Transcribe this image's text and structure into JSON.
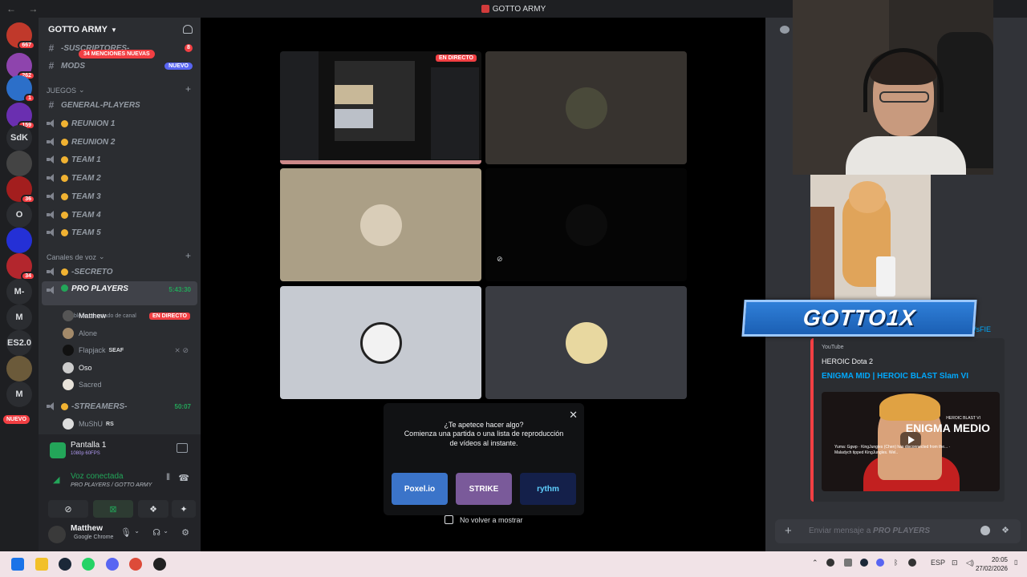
{
  "window": {
    "title": "GOTTO ARMY",
    "nav": "← →"
  },
  "rail": {
    "servers": [
      {
        "label": "",
        "badge": "667",
        "color": "#c0392b"
      },
      {
        "label": "",
        "badge": "262",
        "color": "#8e44ad"
      },
      {
        "label": "",
        "badge": "1",
        "color": "#2c6fc9"
      },
      {
        "label": "",
        "badge": "159",
        "color": "#6a2fb0"
      },
      {
        "label": "SdK",
        "badge": "",
        "color": "#2b2d31"
      },
      {
        "label": "",
        "badge": "",
        "color": "#444"
      },
      {
        "label": "",
        "badge": "36",
        "color": "#a31e1e"
      },
      {
        "label": "O",
        "badge": "",
        "color": "#2b2d31"
      },
      {
        "label": "",
        "badge": "",
        "color": "#2430d6"
      },
      {
        "label": "",
        "badge": "34",
        "color": "#b3262d"
      },
      {
        "label": "M-",
        "badge": "",
        "color": "#2b2d31"
      },
      {
        "label": "M",
        "badge": "",
        "color": "#2b2d31"
      },
      {
        "label": "ES2.0",
        "badge": "",
        "color": "#2b2d31"
      },
      {
        "label": "",
        "badge": "",
        "color": "#6b5a3a"
      },
      {
        "label": "M",
        "badge": "",
        "color": "#2b2d31"
      }
    ],
    "new_label": "NUEVO"
  },
  "guild": {
    "name": "GOTTO ARMY",
    "mentions_pill": "34 MENCIONES NUEVAS"
  },
  "channels": {
    "suscriptores": {
      "name": "-SUSCRIPTORES-",
      "badge": "8"
    },
    "mods": {
      "name": "MODS",
      "tag": "NUEVO"
    },
    "category_games": "JUEGOS",
    "text_channels": [
      "GENERAL-PLAYERS"
    ],
    "voice_channels": [
      "REUNION 1",
      "REUNION 2",
      "TEAM 1",
      "TEAM 2",
      "TEAM 3",
      "TEAM 4",
      "TEAM 5"
    ],
    "category_voice": "Canales de voz",
    "secreto": "-SECRETO",
    "pro_players": {
      "name": "PRO PLAYERS",
      "timer": "5:43:30",
      "status": "Establece un estado de canal"
    },
    "members": [
      {
        "name": "Matthew",
        "live": "EN DIRECTO"
      },
      {
        "name": "Alone"
      },
      {
        "name": "Flapjack",
        "chip": "SEAF"
      },
      {
        "name": "Oso"
      },
      {
        "name": "Sacred"
      }
    ],
    "streamers": {
      "name": "-STREAMERS-",
      "timer": "50:07"
    },
    "streamer_member": {
      "name": "MuShU",
      "chip": "RS"
    }
  },
  "screen_share": {
    "title": "Pantalla 1",
    "quality": "1080p 60FPS"
  },
  "voice": {
    "title": "Voz conectada",
    "location": "PRO PLAYERS / GOTTO ARMY"
  },
  "user": {
    "name": "Matthew",
    "activity": "Google Chrome"
  },
  "stage": {
    "live_badge": "EN DIRECTO"
  },
  "activity": {
    "question": "¿Te apetece hacer algo?",
    "description": "Comienza una partida o una lista de reproducción de vídeos al instante.",
    "apps": [
      {
        "label": "Poxel.io",
        "color": "#3b74c9"
      },
      {
        "label": "STRIKE",
        "color": "#7a5a9a"
      },
      {
        "label": "rythm",
        "color": "#14204a"
      }
    ],
    "checkbox_label": "No volver a mostrar"
  },
  "chat": {
    "embed": {
      "provider": "YouTube",
      "author": "HEROIC Dota 2",
      "title": "ENIGMA MID | HEROIC BLAST Slam VI",
      "thumb_big": "ENIGMA MEDIO",
      "thumb_small": "HEROIC BLAST VI",
      "thumb_chat": "Yuma: Ggwp · KingJungles (Chen) has disconnected from the... · Maladych tipped KingJungles. Wel.."
    },
    "input_placeholder_prefix": "Enviar mensaje a",
    "input_placeholder_channel": "PRO PLAYERS"
  },
  "overlay": {
    "banner": "GOTTO1X",
    "banner_suffix": "/sFIE"
  },
  "taskbar": {
    "lang": "ESP",
    "time": "20:05",
    "date": "27/02/2026"
  }
}
